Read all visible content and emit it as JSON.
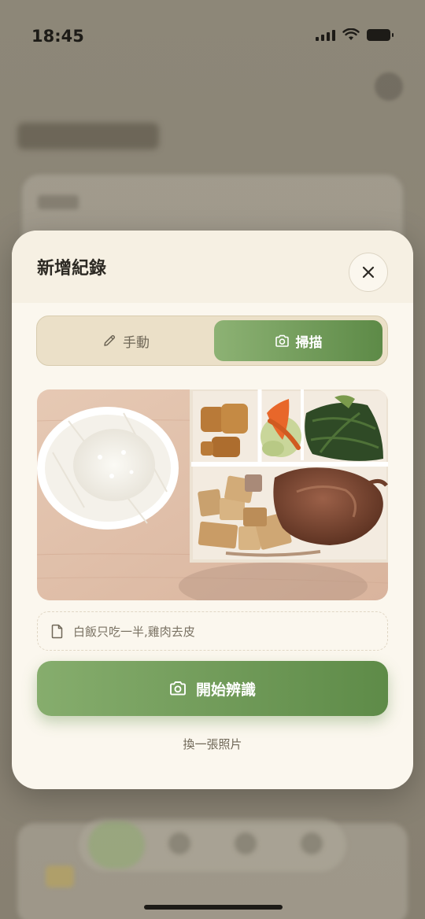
{
  "status_bar": {
    "time": "18:45"
  },
  "modal": {
    "title": "新增紀錄",
    "close_icon": "close-icon",
    "tabs": [
      {
        "label": "手動",
        "icon": "pencil-icon",
        "active": false
      },
      {
        "label": "掃描",
        "icon": "camera-icon",
        "active": true
      }
    ],
    "photo": {
      "icon": "food-photo",
      "description_items": [
        "rice bowl",
        "braised chicken leg",
        "braised tofu",
        "vegetables"
      ]
    },
    "note": {
      "icon": "document-icon",
      "text": "白飯只吃一半,雞肉去皮"
    },
    "start_button": {
      "icon": "camera-icon",
      "label": "開始辨識"
    },
    "change_photo": "換一張照片"
  },
  "colors": {
    "accent_green": "#6a9652",
    "modal_bg": "#fbf7ee",
    "segment_bg": "#ebe0c8",
    "overlay": "#8a8272"
  }
}
